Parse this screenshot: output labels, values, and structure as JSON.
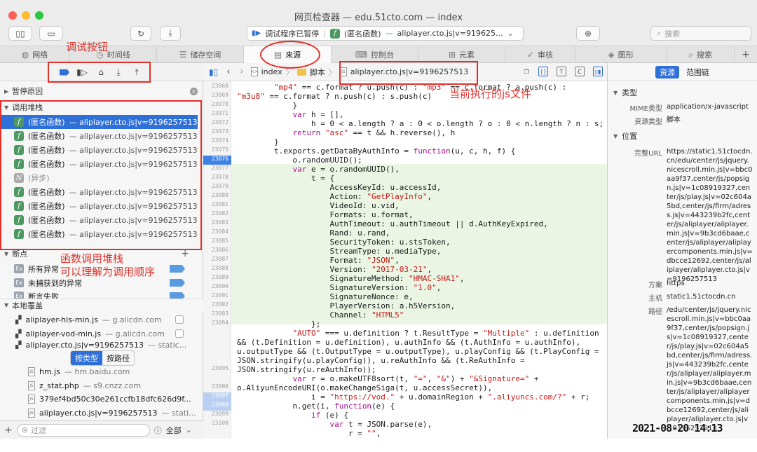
{
  "window": {
    "title": "网页检查器 — edu.51cto.com — index"
  },
  "toolbar": {
    "status_label": "调试程序已暂停",
    "status_func": "(匿名函数)",
    "status_file": "aliplayer.cto.js|v=919625...",
    "search_placeholder": "搜索"
  },
  "tabs": [
    {
      "label": "网络",
      "icon": "network-icon"
    },
    {
      "label": "时间线",
      "icon": "timeline-icon"
    },
    {
      "label": "储存空间",
      "icon": "storage-icon"
    },
    {
      "label": "来源",
      "icon": "sources-icon"
    },
    {
      "label": "控制台",
      "icon": "console-icon"
    },
    {
      "label": "元素",
      "icon": "elements-icon"
    },
    {
      "label": "审核",
      "icon": "audit-icon"
    },
    {
      "label": "图形",
      "icon": "graphics-icon"
    },
    {
      "label": "搜索",
      "icon": "search-icon"
    }
  ],
  "sidebar": {
    "paused_reason": "暂停原因",
    "call_stack_title": "调用堆栈",
    "call_stack": [
      {
        "func": "(匿名函数)",
        "file": "— aliplayer.cto.js|v=9196257513"
      },
      {
        "func": "(匿名函数)",
        "file": "— aliplayer.cto.js|v=9196257513"
      },
      {
        "func": "(匿名函数)",
        "file": "— aliplayer.cto.js|v=9196257513"
      },
      {
        "func": "(匿名函数)",
        "file": "— aliplayer.cto.js|v=9196257513"
      },
      {
        "func": "(异步)",
        "file": ""
      },
      {
        "func": "(匿名函数)",
        "file": "— aliplayer.cto.js|v=9196257513"
      },
      {
        "func": "(匿名函数)",
        "file": "— aliplayer.cto.js|v=9196257513"
      },
      {
        "func": "(匿名函数)",
        "file": "— aliplayer.cto.js|v=9196257513"
      },
      {
        "func": "(匿名函数)",
        "file": "— aliplayer.cto.js|v=9196257513"
      }
    ],
    "breakpoints_title": "断点",
    "breakpoints": [
      {
        "label": "所有异常"
      },
      {
        "label": "未捕获到的异常"
      },
      {
        "label": "断言失败"
      }
    ],
    "local_overrides_title": "本地覆盖",
    "overrides": [
      {
        "name": "aliplayer-hls-min.js",
        "host": "— g.alicdn.com"
      },
      {
        "name": "aliplayer-vod-min.js",
        "host": "— g.alicdn.com"
      },
      {
        "name": "aliplayer.cto.js|v=9196257513",
        "host": "— static..."
      }
    ],
    "seg_by_type": "按类型",
    "seg_by_path": "按路径",
    "resources": [
      {
        "name": "hm.js",
        "host": "— hm.baidu.com"
      },
      {
        "name": "z_stat.php",
        "host": "— s9.cnzz.com"
      },
      {
        "name": "379ef4bd50c30e261ccfb18dfc626d9f...",
        "host": ""
      },
      {
        "name": "aliplayer.cto.js|v=9196257513",
        "host": "— stati..."
      }
    ],
    "filter_placeholder": "过滤",
    "filter_scope": "全部"
  },
  "editor": {
    "breadcrumb_index": "index",
    "breadcrumb_script": "脚本",
    "breadcrumb_file": "aliplayer.cto.js|v=9196257513",
    "line_numbers": [
      "23068",
      "23069",
      "23070",
      "23071",
      "23072",
      "23073",
      "23074",
      "23075",
      "23076",
      "23077",
      "23078",
      "23079",
      "23080",
      "23081",
      "23082",
      "23083",
      "23084",
      "23085",
      "23086",
      "23087",
      "23088",
      "23089",
      "23090",
      "23091",
      "23092",
      "23093",
      "23094",
      "",
      "",
      "",
      "",
      "23095",
      "",
      "23096",
      "23097",
      "23098",
      "23099",
      "23100"
    ],
    "current_line": "23076",
    "breakpoint_lines": [
      "23097",
      "23098"
    ]
  },
  "details": {
    "tab_resource": "资源",
    "tab_scope": "范围链",
    "type_section": "类型",
    "mime_label": "MIME类型",
    "mime_value": "application/x-javascript",
    "restype_label": "资源类型",
    "restype_value": "脚本",
    "location_section": "位置",
    "url_label": "完整URL",
    "url_value": "https://static1.51ctocdn.cn/edu/center/js/jquery.nicescroll.min.js|v=bbc0aa9f37,center/js/popsign.js|v=1c08919327,center/js/play.js|v=02c604a5bd,center/js/firm/adress.js|v=443239b2fc,center/js/aliplayer/aliplayer.min.js|v=9b3cd6baae,center/js/aliplayer/aliplayercomponents.min.js|v=dbcce12692,center/js/aliplayer/aliplayer.cto.js|v=9196257513",
    "scheme_label": "方案",
    "scheme_value": "https",
    "host_label": "主机",
    "host_value": "static1.51ctocdn.cn",
    "path_label": "路径",
    "path_value": "/edu/center/js/jquery.nicescroll.min.js|v=bbc0aa9f37,center/js/popsign.js|v=1c08919327,center/js/play.js|v=02c604a5bd,center/js/firm/adress.js|v=443239b2fc,center/js/aliplayer/aliplayer.min.js|v=9b3cd6baae,center/js/aliplayer/aliplayercomponents.min.js|v=dbcce12692,center/js/aliplayer/aliplayer.cto.js|v=9196257513"
  },
  "annotations": {
    "debug_buttons": "调试按钮",
    "current_file": "当前执行的js文件",
    "call_stack_line1": "函数调用堆栈",
    "call_stack_line2": "可以理解为调用顺序"
  },
  "timestamp": "2021-08-20 14:13",
  "colors": {
    "selection": "#2f6fd8",
    "annotation": "#e0312b",
    "highlight": "#eaf5e3"
  }
}
